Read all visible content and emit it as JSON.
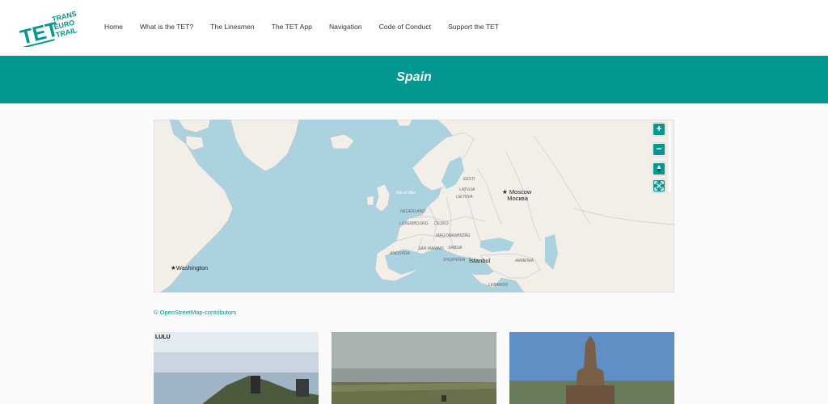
{
  "logo": {
    "mark": "TET",
    "line1": "TRANS",
    "line2": "EURO",
    "line3": "TRAIL"
  },
  "nav": [
    "Home",
    "What is the TET?",
    "The Linesmen",
    "The TET App",
    "Navigation",
    "Code of Conduct",
    "Support the TET"
  ],
  "page_title": "Spain",
  "map": {
    "zoom_in": "+",
    "zoom_out": "−",
    "cities": {
      "moscow": "Moscow",
      "moscow_local": "Москва",
      "washington": "Washington",
      "istanbul": "İstanbul"
    },
    "labels": [
      "EESTI",
      "LATVIJA",
      "LIETUVA",
      "NEDERLAND",
      "LUXEMBOURG",
      "ČESKO",
      "MAGYARORSZÁG",
      "SAN MARINO",
      "SRBIJA",
      "ANDORRA",
      "SHQIPËRIA",
      "ARMENIA",
      "LEBANON",
      "Isle of Man"
    ]
  },
  "attribution": "© OpenStreetMap-contributors",
  "cards": [
    {
      "overlay_text": "LULU"
    },
    {
      "overlay_text": ""
    },
    {
      "overlay_text": ""
    }
  ],
  "colors": {
    "accent": "#009890",
    "sea": "#aad3df",
    "land": "#f2efe9"
  }
}
